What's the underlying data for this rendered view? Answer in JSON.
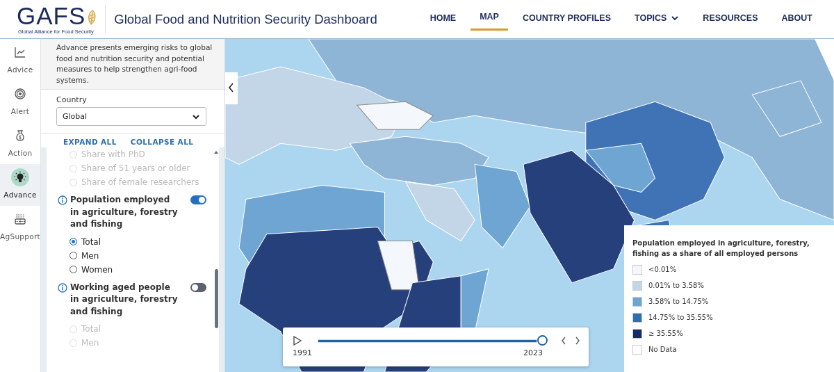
{
  "header": {
    "logo_text": "GAFS",
    "logo_subtitle": "Global Alliance for Food Security",
    "title": "Global Food and Nutrition Security Dashboard",
    "nav": [
      {
        "label": "HOME",
        "selected": false,
        "dropdown": false
      },
      {
        "label": "MAP",
        "selected": true,
        "dropdown": false
      },
      {
        "label": "COUNTRY PROFILES",
        "selected": false,
        "dropdown": false
      },
      {
        "label": "TOPICS",
        "selected": false,
        "dropdown": true
      },
      {
        "label": "RESOURCES",
        "selected": false,
        "dropdown": false
      },
      {
        "label": "ABOUT",
        "selected": false,
        "dropdown": false
      }
    ]
  },
  "sidebar": {
    "items": [
      {
        "label": "Advice",
        "selected": false
      },
      {
        "label": "Alert",
        "selected": false
      },
      {
        "label": "Action",
        "selected": false
      },
      {
        "label": "Advance",
        "selected": true
      },
      {
        "label": "AgSupport",
        "selected": false
      }
    ]
  },
  "panel": {
    "description": "Advance presents emerging risks to global food and nutrition security and potential measures to help strengthen agri-food systems.",
    "country_label": "Country",
    "country_value": "Global",
    "expand_all": "EXPAND ALL",
    "collapse_all": "COLLAPSE ALL",
    "list": [
      {
        "kind": "radio",
        "label": "Share with PhD",
        "selected": false,
        "disabled": true
      },
      {
        "kind": "radio",
        "label": "Share of 51 years or older",
        "selected": false,
        "disabled": true
      },
      {
        "kind": "radio",
        "label": "Share of female researchers",
        "selected": false,
        "disabled": true
      },
      {
        "kind": "toggle",
        "label": "Population employed in agriculture, forestry and fishing",
        "on": true
      },
      {
        "kind": "radio",
        "label": "Total",
        "selected": true,
        "disabled": false
      },
      {
        "kind": "radio",
        "label": "Men",
        "selected": false,
        "disabled": false
      },
      {
        "kind": "radio",
        "label": "Women",
        "selected": false,
        "disabled": false
      },
      {
        "kind": "toggle",
        "label": "Working aged people in agriculture, forestry and fishing",
        "on": false
      },
      {
        "kind": "radio",
        "label": "Total",
        "selected": false,
        "disabled": true
      },
      {
        "kind": "radio",
        "label": "Men",
        "selected": false,
        "disabled": true
      }
    ]
  },
  "timeline": {
    "start": "1991",
    "end": "2023",
    "level": 1.0
  },
  "legend": {
    "title": "Population employed in agriculture, forestry, fishing as a share of all employed persons",
    "items": [
      {
        "label": "<0.01%",
        "color": "#f4f7fc"
      },
      {
        "label": "0.01% to 3.58%",
        "color": "#c3d6e8"
      },
      {
        "label": "3.58% to 14.75%",
        "color": "#6fa5d3"
      },
      {
        "label": "14.75% to 35.55%",
        "color": "#2e6db3"
      },
      {
        "label": "≥ 35.55%",
        "color": "#142a6a"
      },
      {
        "label": "No Data",
        "color": "#ffffff"
      }
    ]
  }
}
